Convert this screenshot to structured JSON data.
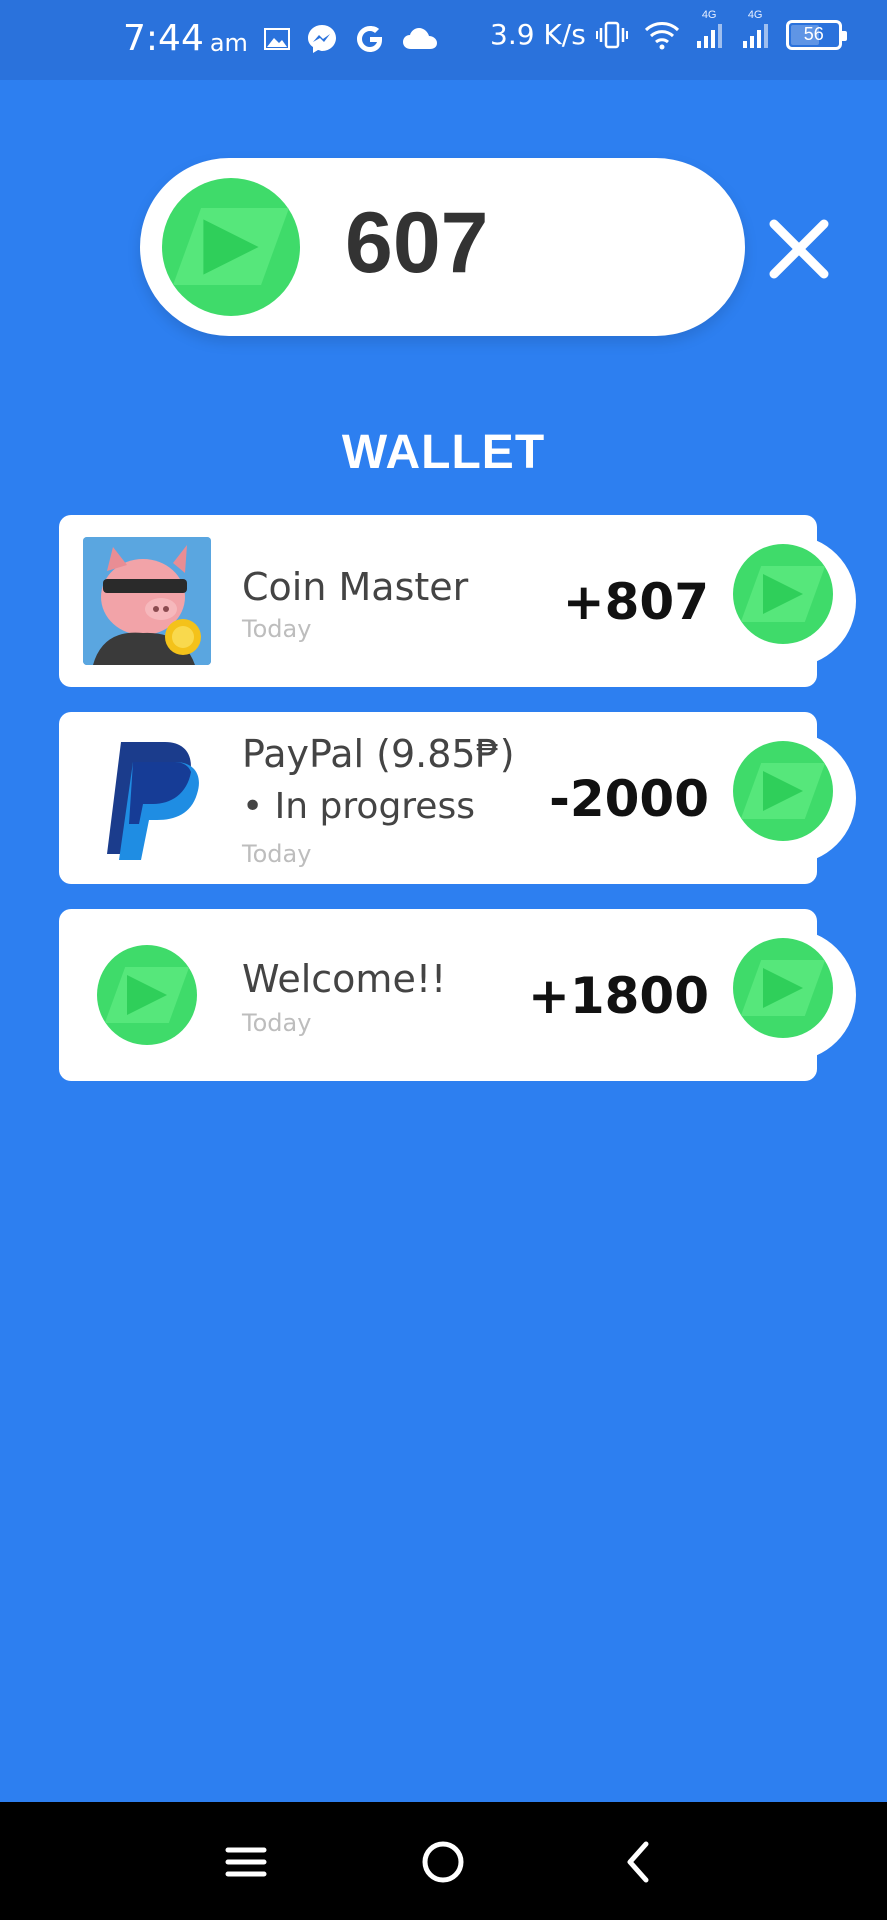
{
  "status_bar": {
    "time": "7:44",
    "ampm": "am",
    "net_speed": "3.9 K/s",
    "net_label_1": "4G",
    "net_label_2": "4G",
    "battery": "56",
    "battery_level": 0.56,
    "icons": [
      "gallery-icon",
      "messenger-icon",
      "google-icon",
      "cloud-icon",
      "vibrate-icon",
      "wifi-icon",
      "signal-icon",
      "signal-icon",
      "battery-icon"
    ]
  },
  "balance": {
    "value": "607"
  },
  "wallet": {
    "title": "WALLET",
    "transactions": [
      {
        "name": "Coin Master",
        "status": "",
        "date": "Today",
        "amount": "+807",
        "icon": "coin-master-pig-icon"
      },
      {
        "name": "PayPal (9.85₱)",
        "status": "• In progress",
        "date": "Today",
        "amount": "-2000",
        "icon": "paypal-icon"
      },
      {
        "name": "Welcome!!",
        "status": "",
        "date": "Today",
        "amount": "+1800",
        "icon": "coin-icon"
      }
    ]
  },
  "colors": {
    "background": "#2d7ff0",
    "status_bar": "#2a72dc",
    "coin_green": "#3fdb6a",
    "card": "#ffffff",
    "nav_bar": "#000000"
  },
  "nav": {
    "icons": [
      "menu-icon",
      "home-icon",
      "back-icon"
    ]
  }
}
